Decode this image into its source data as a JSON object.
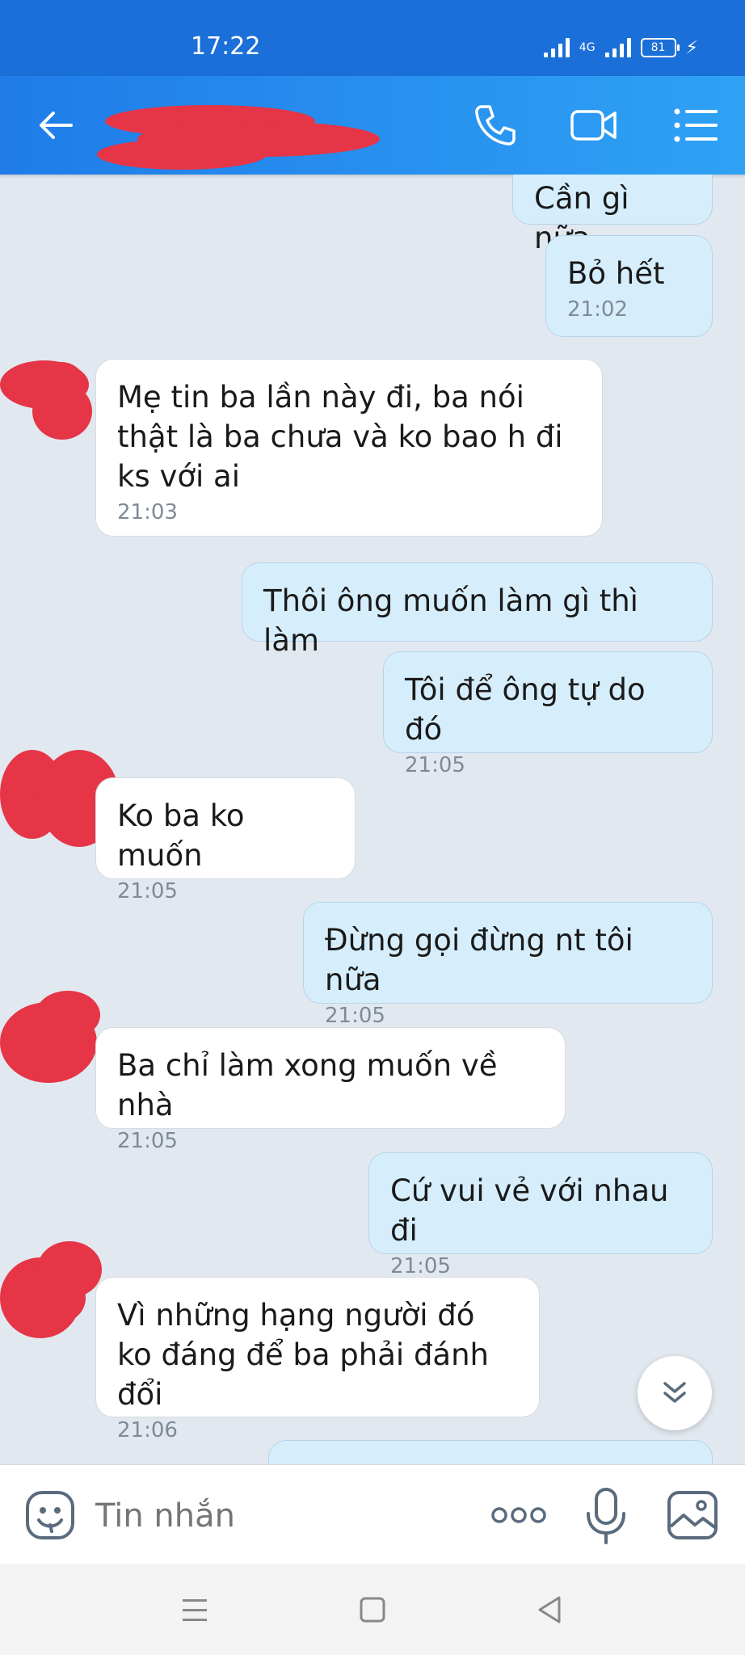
{
  "status": {
    "time": "17:22",
    "network": "4G",
    "battery": "81"
  },
  "header": {
    "contact_name": ""
  },
  "messages": [
    {
      "side": "out",
      "text": "Cần gì nữa",
      "time": ""
    },
    {
      "side": "out",
      "text": "Bỏ hết",
      "time": "21:02"
    },
    {
      "side": "in",
      "text": "Mẹ tin ba lần này đi, ba nói thật là ba chưa và ko bao h đi ks với ai",
      "time": "21:03"
    },
    {
      "side": "out",
      "text": "Thôi ông muốn làm gì thì làm",
      "time": ""
    },
    {
      "side": "out",
      "text": "Tôi để ông tự do đó",
      "time": "21:05"
    },
    {
      "side": "in",
      "text": "Ko ba ko muốn",
      "time": "21:05"
    },
    {
      "side": "out",
      "text": "Đừng gọi đừng nt tôi nữa",
      "time": "21:05"
    },
    {
      "side": "in",
      "text": "Ba chỉ làm xong muốn về nhà",
      "time": "21:05"
    },
    {
      "side": "out",
      "text": "Cứ vui vẻ với nhau đi",
      "time": "21:05"
    },
    {
      "side": "in",
      "text": "Vì những hạng người đó ko đáng để ba phải đánh đổi",
      "time": "21:06"
    }
  ],
  "composer": {
    "placeholder": "Tin nhắn"
  },
  "colors": {
    "header": "#1f7ce8",
    "outgoing_bubble": "#d6eefc",
    "incoming_bubble": "#ffffff",
    "redaction": "#e53547"
  }
}
